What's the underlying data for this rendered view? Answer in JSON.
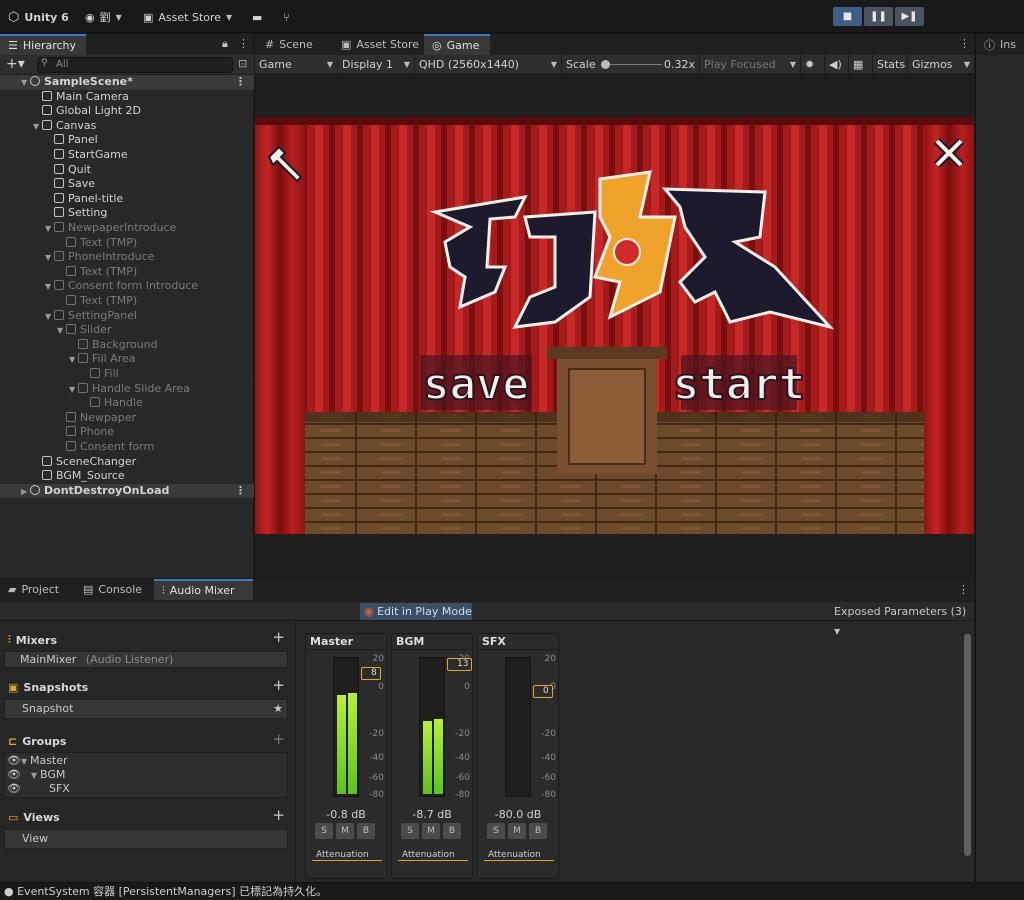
{
  "toolbar": {
    "app_name": "Unity 6",
    "account": "劉",
    "asset_store": "Asset Store"
  },
  "hierarchy": {
    "tab": "Hierarchy",
    "search_placeholder": "All",
    "rows": [
      {
        "label": "SampleScene*",
        "depth": 0,
        "dim": false,
        "scene": true
      },
      {
        "label": "Main Camera",
        "depth": 1,
        "dim": false
      },
      {
        "label": "Global Light 2D",
        "depth": 1,
        "dim": false
      },
      {
        "label": "Canvas",
        "depth": 1,
        "dim": false
      },
      {
        "label": "Panel",
        "depth": 2,
        "dim": false
      },
      {
        "label": "StartGame",
        "depth": 2,
        "dim": false
      },
      {
        "label": "Quit",
        "depth": 2,
        "dim": false
      },
      {
        "label": "Save",
        "depth": 2,
        "dim": false
      },
      {
        "label": "Panel-title",
        "depth": 2,
        "dim": false
      },
      {
        "label": "Setting",
        "depth": 2,
        "dim": false
      },
      {
        "label": "NewpaperIntroduce",
        "depth": 2,
        "dim": true
      },
      {
        "label": "Text (TMP)",
        "depth": 3,
        "dim": true
      },
      {
        "label": "PhoneIntroduce",
        "depth": 2,
        "dim": true
      },
      {
        "label": "Text (TMP)",
        "depth": 3,
        "dim": true
      },
      {
        "label": "Consent form Introduce",
        "depth": 2,
        "dim": true
      },
      {
        "label": "Text (TMP)",
        "depth": 3,
        "dim": true
      },
      {
        "label": "SettingPanel",
        "depth": 2,
        "dim": true
      },
      {
        "label": "Slider",
        "depth": 3,
        "dim": true
      },
      {
        "label": "Background",
        "depth": 4,
        "dim": true
      },
      {
        "label": "Fill Area",
        "depth": 4,
        "dim": true
      },
      {
        "label": "Fill",
        "depth": 5,
        "dim": true
      },
      {
        "label": "Handle Slide Area",
        "depth": 4,
        "dim": true
      },
      {
        "label": "Handle",
        "depth": 5,
        "dim": true
      },
      {
        "label": "Newpaper",
        "depth": 3,
        "dim": true
      },
      {
        "label": "Phone",
        "depth": 3,
        "dim": true
      },
      {
        "label": "Consent form",
        "depth": 3,
        "dim": true
      },
      {
        "label": "SceneChanger",
        "depth": 1,
        "dim": false
      },
      {
        "label": "BGM_Source",
        "depth": 1,
        "dim": false
      },
      {
        "label": "DontDestroyOnLoad",
        "depth": 0,
        "dim": false,
        "scene": true
      }
    ]
  },
  "view_tabs": {
    "scene": "Scene",
    "asset_store": "Asset Store",
    "game": "Game"
  },
  "game_bar": {
    "mode": "Game",
    "display": "Display 1",
    "resolution": "QHD (2560x1440)",
    "scale_label": "Scale",
    "scale_value": "0.32x",
    "play_focused": "Play Focused",
    "stats": "Stats",
    "gizmos": "Gizmos"
  },
  "game": {
    "save_text": "save",
    "start_text": "start"
  },
  "inspector_tab": "Inspe",
  "bottom_tabs": {
    "project": "Project",
    "console": "Console",
    "audio_mixer": "Audio Mixer"
  },
  "mixer": {
    "edit_in_play_mode": "Edit in Play Mode",
    "exposed_params": "Exposed Parameters (3)",
    "mixers_title": "Mixers",
    "mixer_name": "MainMixer",
    "mixer_note": "(Audio Listener)",
    "snapshots_title": "Snapshots",
    "snapshot_name": "Snapshot",
    "groups_title": "Groups",
    "groups": [
      "Master",
      "BGM",
      "SFX"
    ],
    "views_title": "Views",
    "view_name": "View",
    "scale_ticks": [
      "20",
      "0",
      "-20",
      "-40",
      "-60",
      "-80"
    ],
    "strips": [
      {
        "name": "Master",
        "db": "-0.8 dB",
        "tag": "8",
        "level": 0.72
      },
      {
        "name": "BGM",
        "db": "-8.7 dB",
        "tag": "13",
        "level": 0.53
      },
      {
        "name": "SFX",
        "db": "-80.0 dB",
        "tag": "0",
        "level": 0.0
      }
    ],
    "s_label": "S",
    "m_label": "M",
    "b_label": "B",
    "attenuation": "Attenuation"
  },
  "status": {
    "message": "EventSystem 容器 [PersistentManagers] 已標記為持久化。"
  }
}
